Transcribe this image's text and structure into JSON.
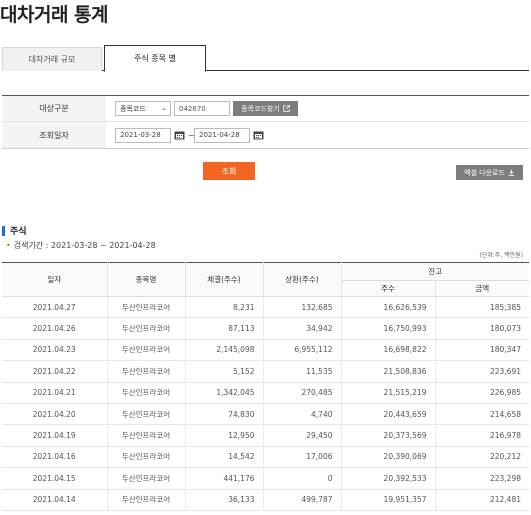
{
  "page_title": "대차거래 통계",
  "tabs": [
    {
      "label": "대차거래 규모"
    },
    {
      "label": "주식 종목 별"
    }
  ],
  "search": {
    "target_label": "대상구분",
    "target_select": "종목코드",
    "code_value": "042670",
    "find_button": "종목코드찾기",
    "date_label": "조회일자",
    "date_from": "2021-03-28",
    "date_to": "2021-04-28",
    "tilde": "~"
  },
  "query_button": "조회",
  "excel_button": "엑셀 다운로드",
  "section": {
    "title": "주식",
    "period": "검색기간 : 2021-03-28 ~ 2021-04-28",
    "unit": "(단위:주, 백만원)"
  },
  "table": {
    "headers": {
      "date": "일자",
      "name": "종목명",
      "trade": "체결(주수)",
      "repay": "상환(주수)",
      "balance": "잔고",
      "balance_shares": "주수",
      "balance_amount": "금액"
    },
    "rows": [
      [
        "2021.04.27",
        "두산인프라코어",
        "8,231",
        "132,685",
        "16,626,539",
        "185,385"
      ],
      [
        "2021.04.26",
        "두산인프라코어",
        "87,113",
        "34,942",
        "16,750,993",
        "180,073"
      ],
      [
        "2021.04.23",
        "두산인프라코어",
        "2,145,098",
        "6,955,112",
        "16,698,822",
        "180,347"
      ],
      [
        "2021.04.22",
        "두산인프라코어",
        "5,152",
        "11,535",
        "21,508,836",
        "223,691"
      ],
      [
        "2021.04.21",
        "두산인프라코어",
        "1,342,045",
        "270,485",
        "21,515,219",
        "226,985"
      ],
      [
        "2021.04.20",
        "두산인프라코어",
        "74,830",
        "4,740",
        "20,443,659",
        "214,658"
      ],
      [
        "2021.04.19",
        "두산인프라코어",
        "12,950",
        "29,450",
        "20,373,569",
        "216,978"
      ],
      [
        "2021.04.16",
        "두산인프라코어",
        "14,542",
        "17,006",
        "20,390,069",
        "220,212"
      ],
      [
        "2021.04.15",
        "두산인프라코어",
        "441,176",
        "0",
        "20,392,533",
        "223,298"
      ],
      [
        "2021.04.14",
        "두산인프라코어",
        "36,133",
        "499,787",
        "19,951,357",
        "212,481"
      ]
    ]
  }
}
